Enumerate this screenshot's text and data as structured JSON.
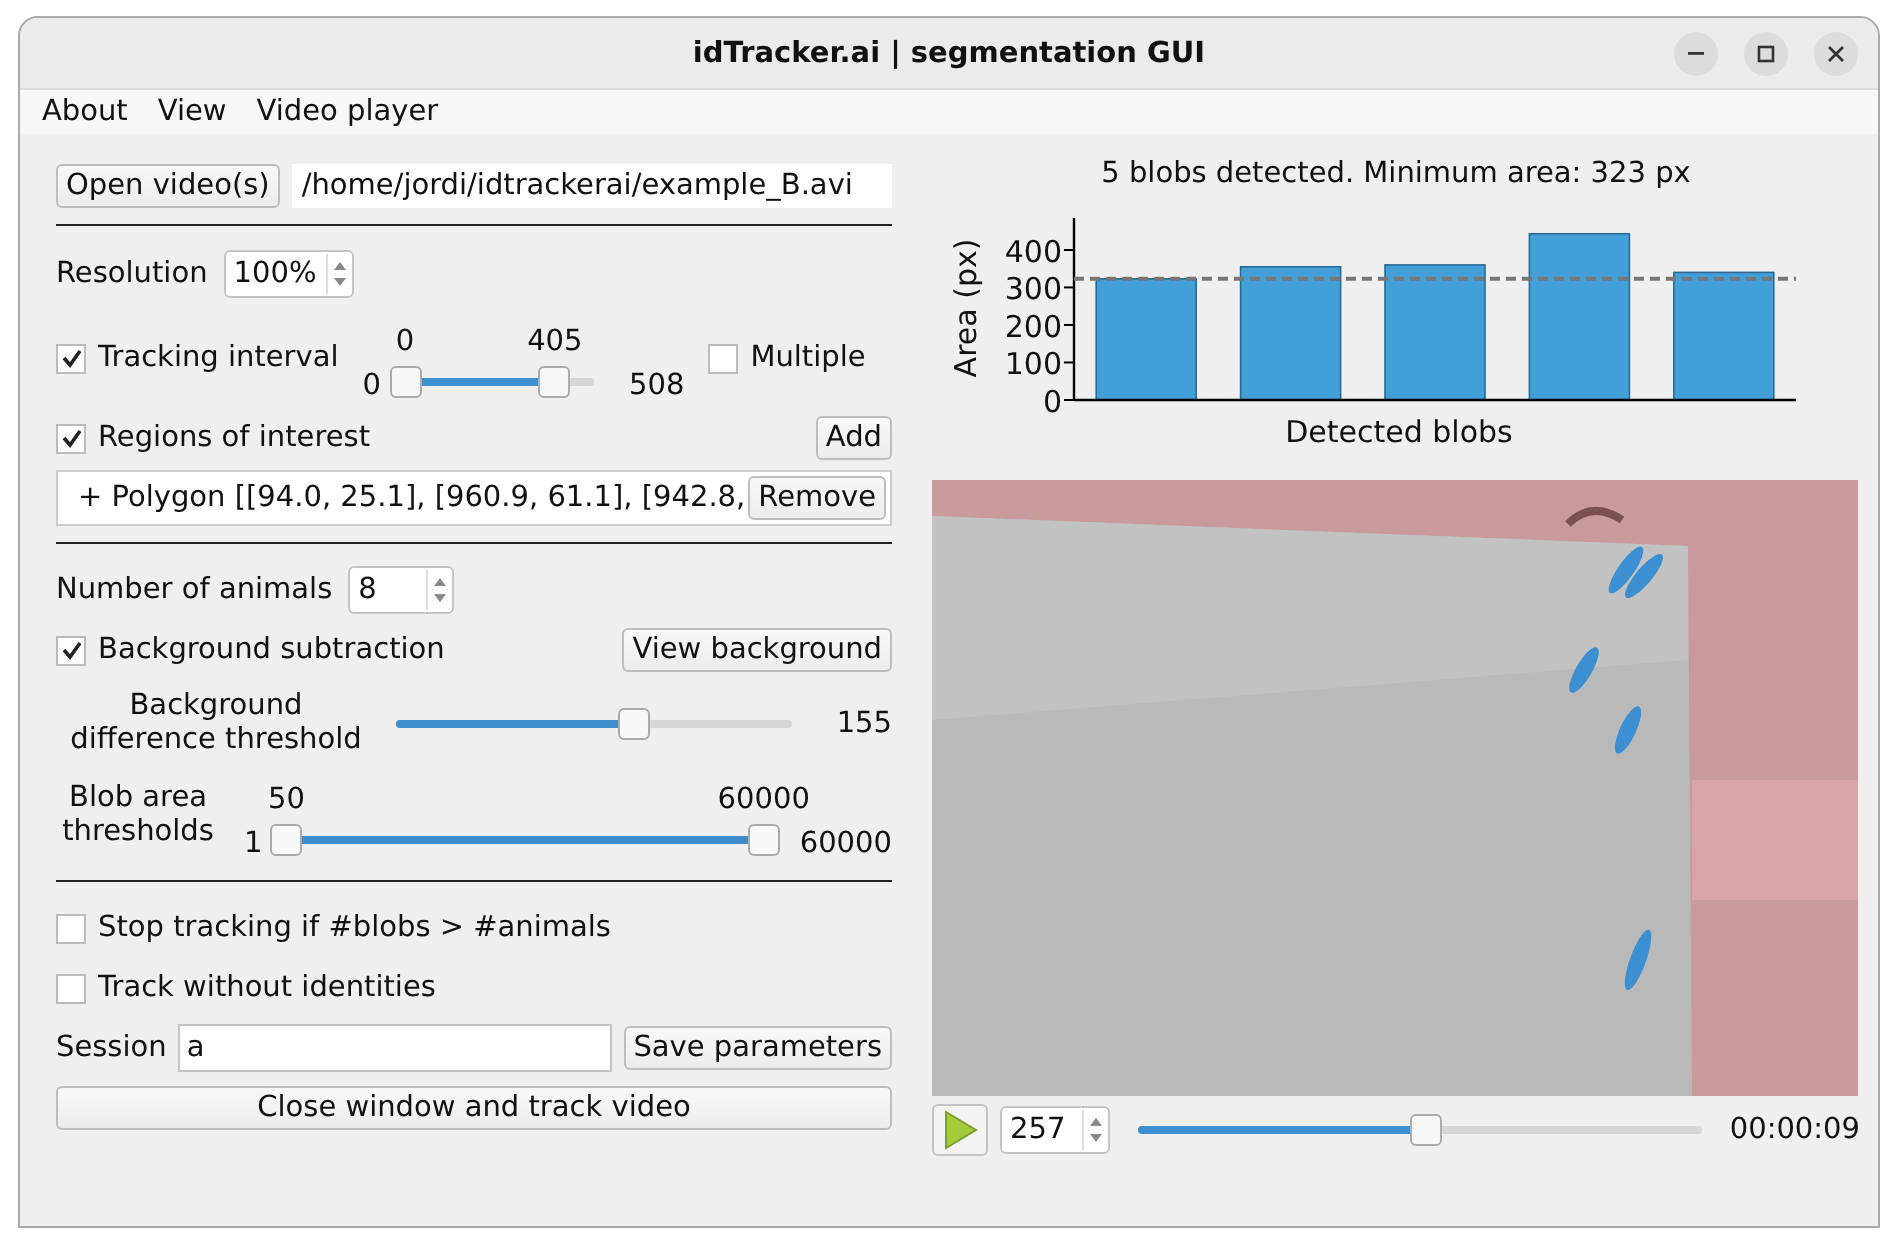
{
  "window": {
    "title": "idTracker.ai | segmentation GUI"
  },
  "menu": [
    {
      "label": "About"
    },
    {
      "label": "View"
    },
    {
      "label": "Video player"
    }
  ],
  "video_file": {
    "button": "Open video(s)",
    "path": "/home/jordi/idtrackerai/example_B.avi"
  },
  "resolution": {
    "label": "Resolution",
    "value": "100%"
  },
  "tracking_interval": {
    "label": "Tracking interval",
    "checked": true,
    "min": "0",
    "max": "508",
    "handles": [
      {
        "value": "0",
        "level": 0
      },
      {
        "value": "405",
        "level": 0.797
      }
    ],
    "multiple": {
      "label": "Multiple",
      "checked": false
    }
  },
  "regions_of_interest": {
    "label": "Regions of interest",
    "checked": true,
    "add_button": "Add",
    "items": [
      {
        "text": "+ Polygon [[94.0, 25.1], [960.9, 61.1], [942.8,",
        "remove_button": "Remove"
      }
    ]
  },
  "number_of_animals": {
    "label": "Number of animals",
    "value": "8"
  },
  "background_subtraction": {
    "label": "Background subtraction",
    "checked": true,
    "button": "View background"
  },
  "background_threshold": {
    "label": "Background difference threshold",
    "level": 0.6,
    "value": "155"
  },
  "blob_area": {
    "label": "Blob area thresholds",
    "min": "1",
    "max": "60000",
    "handles": [
      {
        "value": "50",
        "level": 0
      },
      {
        "value": "60000",
        "level": 1
      }
    ]
  },
  "options": [
    {
      "label": "Stop tracking if #blobs > #animals",
      "checked": false
    },
    {
      "label": "Track without identities",
      "checked": false
    }
  ],
  "session": {
    "label": "Session",
    "value": "a",
    "button": "Save parameters"
  },
  "close_button": "Close window and track video",
  "detection": {
    "summary": "5 blobs detected. Minimum area: 323 px",
    "chart_data": {
      "type": "bar",
      "xlabel": "Detected blobs",
      "ylabel": "Area (px)",
      "values": [
        323,
        355,
        360,
        443,
        340
      ],
      "ylim": [
        0,
        485
      ],
      "yticks": [
        0,
        100,
        200,
        300,
        400
      ],
      "ref_lines": [
        {
          "axis": "y",
          "value": 323
        }
      ]
    }
  },
  "player": {
    "frame": "257",
    "level": 0.51,
    "time": "00:00:09"
  }
}
